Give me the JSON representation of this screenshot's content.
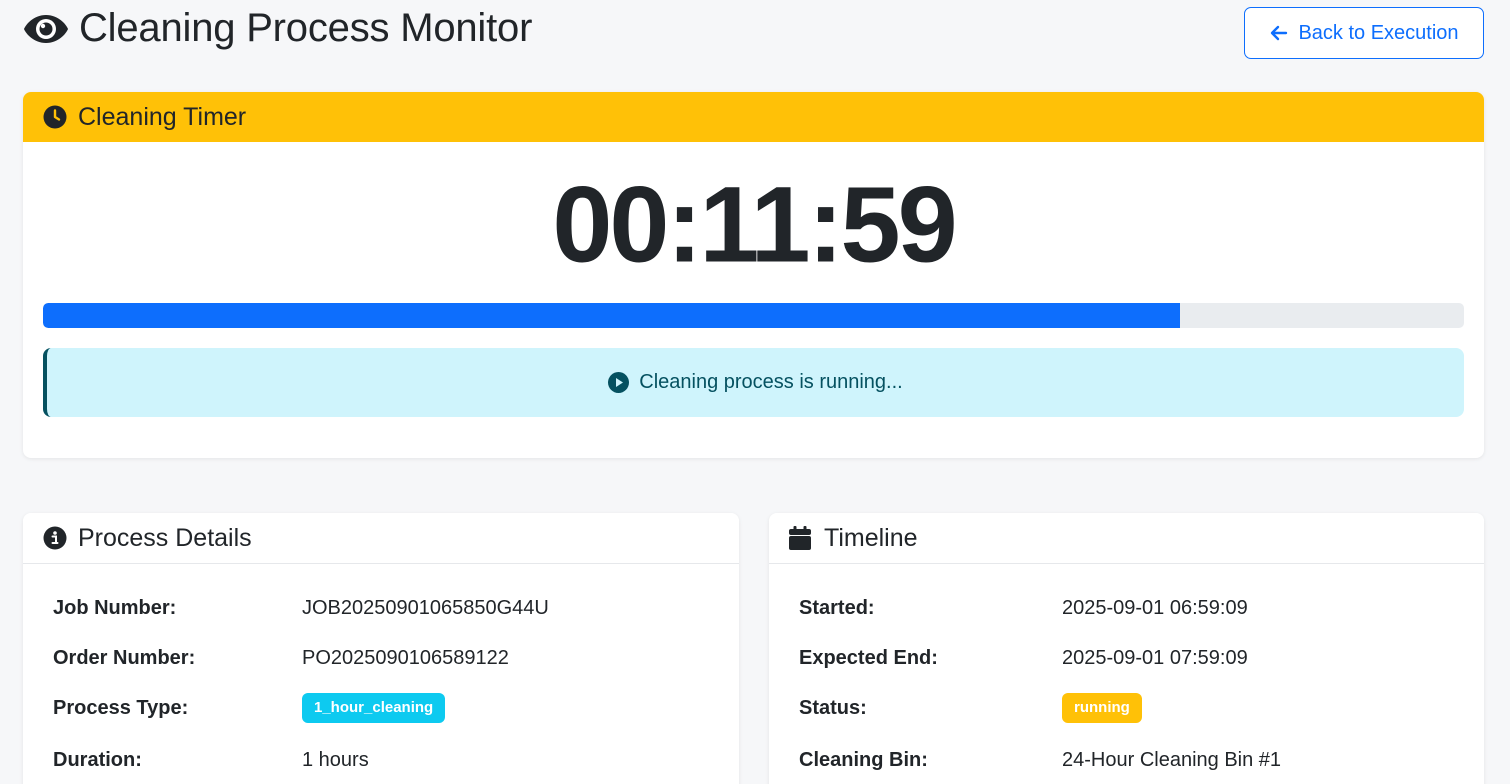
{
  "header": {
    "title": "Cleaning Process Monitor",
    "back_label": "Back to Execution"
  },
  "timer": {
    "title": "Cleaning Timer",
    "value": "00:11:59",
    "progress_fraction": 0.8,
    "status_message": "Cleaning process is running..."
  },
  "details": {
    "title": "Process Details",
    "rows": [
      {
        "label": "Job Number:",
        "value": "JOB20250901065850G44U"
      },
      {
        "label": "Order Number:",
        "value": "PO2025090106589122"
      },
      {
        "label": "Process Type:",
        "value": "1_hour_cleaning"
      },
      {
        "label": "Duration:",
        "value": "1 hours"
      }
    ]
  },
  "timeline": {
    "title": "Timeline",
    "rows": [
      {
        "label": "Started:",
        "value": "2025-09-01 06:59:09"
      },
      {
        "label": "Expected End:",
        "value": "2025-09-01 07:59:09"
      },
      {
        "label": "Status:",
        "value": "running"
      },
      {
        "label": "Cleaning Bin:",
        "value": "24-Hour Cleaning Bin #1"
      }
    ]
  },
  "icons": {
    "title": "eye-icon",
    "back": "arrow-left-icon",
    "timer": "clock-icon",
    "status": "play-circle-icon",
    "details": "info-circle-icon",
    "timeline": "calendar-icon"
  },
  "colors": {
    "primary": "#0d6efd",
    "warning": "#ffc107",
    "info": "#0dcaf0",
    "alert_bg": "#cff4fc",
    "alert_text": "#055160"
  }
}
